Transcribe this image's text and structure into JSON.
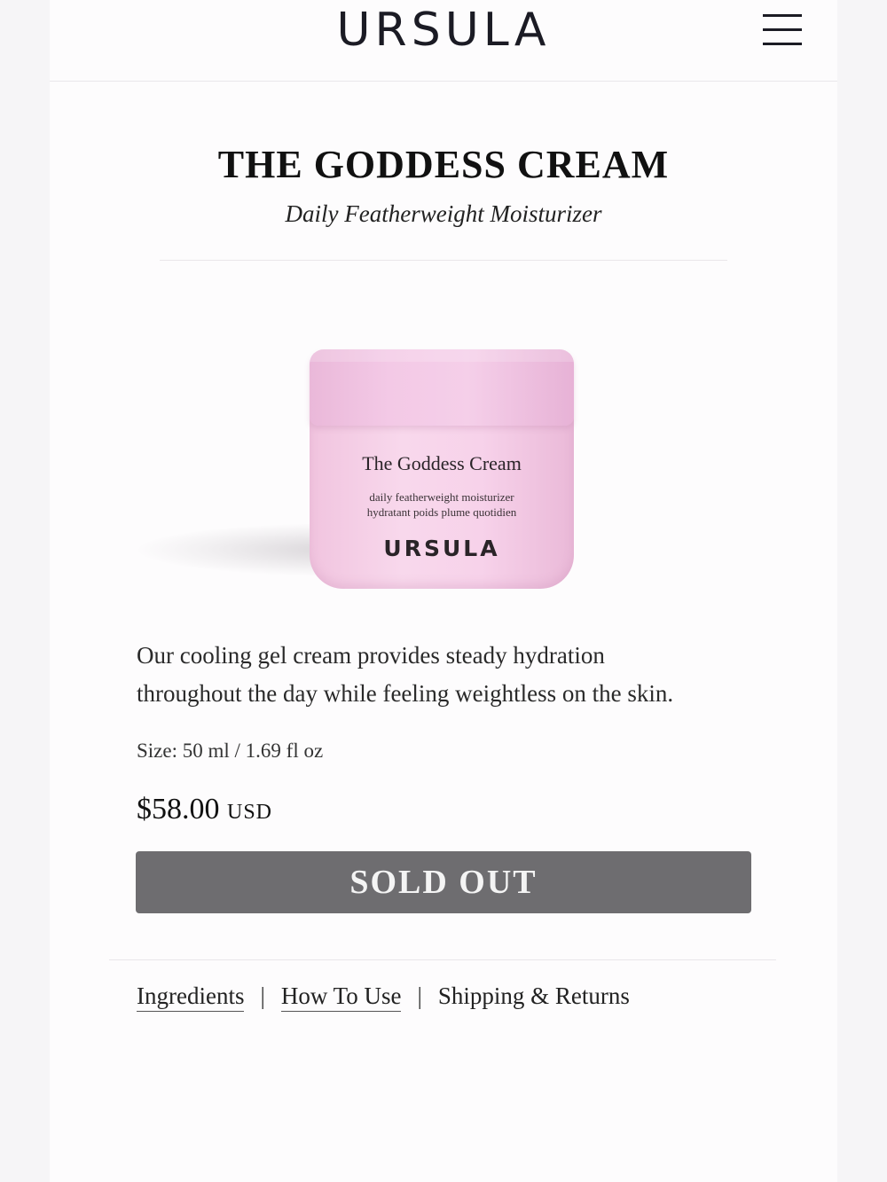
{
  "header": {
    "brand": "URSULA"
  },
  "product": {
    "title": "THE GODDESS CREAM",
    "subtitle": "Daily Featherweight Moisturizer",
    "jar_label": {
      "name": "The Goddess Cream",
      "line1": "daily featherweight moisturizer",
      "line2": "hydratant poids plume quotidien",
      "brand": "URSULA"
    },
    "description_line1": "Our cooling gel cream provides steady hydration",
    "description_line2": "throughout the day while feeling weightless on the skin.",
    "size": "Size: 50 ml / 1.69 fl oz",
    "price_amount": "$58.00",
    "price_currency": "USD",
    "button_label": "SOLD OUT"
  },
  "tabs": [
    {
      "label": "Ingredients"
    },
    {
      "label": "How To Use"
    },
    {
      "label": "Shipping & Returns"
    }
  ],
  "tab_separator": "|",
  "colors": {
    "jar_pink": "#f5cfe9",
    "button_gray": "#6e6d70"
  }
}
